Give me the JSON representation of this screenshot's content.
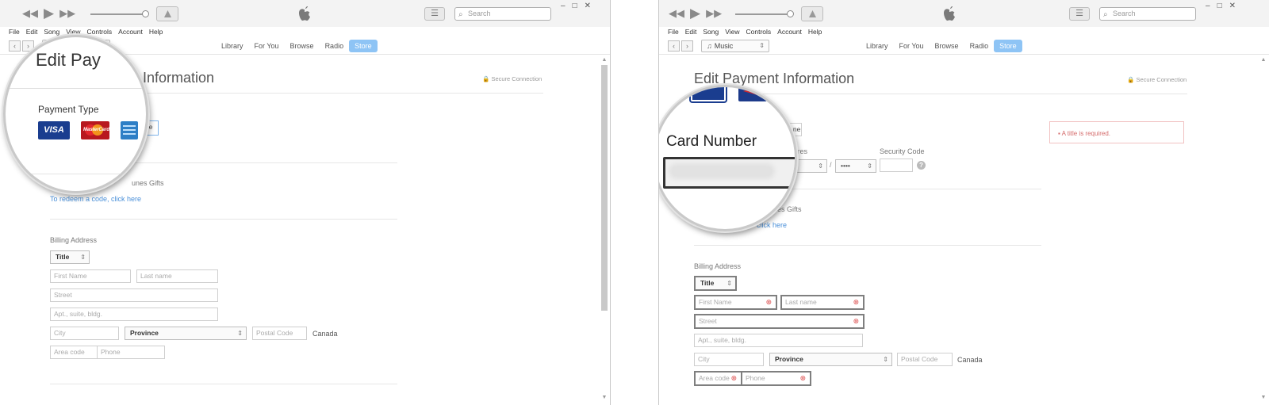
{
  "window": {
    "search_placeholder": "Search",
    "window_controls": [
      "–",
      "□",
      "✕"
    ]
  },
  "menu": [
    "File",
    "Edit",
    "Song",
    "View",
    "Controls",
    "Account",
    "Help"
  ],
  "nav": {
    "media_select": "Music",
    "tabs": [
      "Library",
      "For You",
      "Browse",
      "Radio",
      "Store"
    ],
    "active_tab": "Store"
  },
  "page": {
    "heading": "Edit Payment Information",
    "secure": "Secure Connection",
    "itunes_gifts": "iTunes Gifts",
    "redeem_link": "To redeem a code, click here",
    "billing_label": "Billing Address",
    "country": "Canada",
    "expires_label": "Expires",
    "security_label": "Security Code",
    "month_value": "••",
    "year_value": "••••",
    "none_button": "None",
    "fields": {
      "title": "Title",
      "first_name": "First Name",
      "last_name": "Last name",
      "street": "Street",
      "apt": "Apt., suite, bldg.",
      "city": "City",
      "province": "Province",
      "postal": "Postal Code",
      "area": "Area code",
      "phone": "Phone"
    },
    "error_message": "A title is required."
  },
  "left_magnifier": {
    "heading_fragment": "Edit Pay",
    "heading_rest": "ent Information",
    "payment_type_label": "Payment Type",
    "cards": [
      "VISA",
      "MasterCard",
      "American Express"
    ],
    "none_fragment": "ne",
    "gifts_fragment": "unes Gifts",
    "redeem_fragment": "To redeem a code, click here"
  },
  "right_magnifier": {
    "card_number_label": "Card Number",
    "gifts_fragment": "unes Gifts",
    "redeem_fragment": "click here",
    "expires_fragment": "xpires",
    "none_fragment": "None"
  },
  "colors": {
    "accent": "#8ec4f5",
    "link": "#4a90d9",
    "error": "#d46a6a"
  }
}
